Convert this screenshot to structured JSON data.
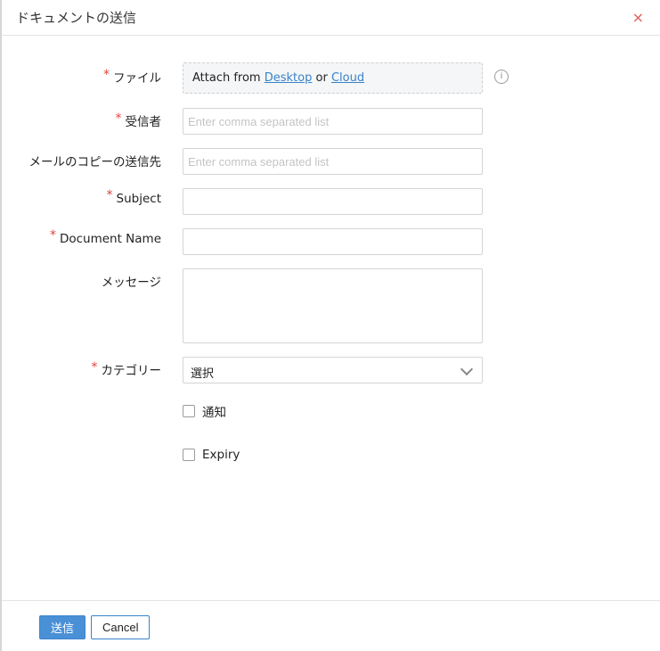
{
  "dialog": {
    "title": "ドキュメントの送信",
    "close_icon": "×"
  },
  "form": {
    "required_marker": "*",
    "file": {
      "label": "ファイル",
      "attach_prefix": "Attach from",
      "desktop_link": "Desktop",
      "or_text": "or",
      "cloud_link": "Cloud",
      "info_icon": "i"
    },
    "recipients": {
      "label": "受信者",
      "placeholder": "Enter comma separated list",
      "value": ""
    },
    "cc": {
      "label": "メールのコピーの送信先",
      "placeholder": "Enter comma separated list",
      "value": ""
    },
    "subject": {
      "label": "Subject",
      "value": ""
    },
    "document_name": {
      "label": "Document Name",
      "value": ""
    },
    "message": {
      "label": "メッセージ",
      "value": ""
    },
    "category": {
      "label": "カテゴリー",
      "selected": "選択"
    },
    "notify": {
      "label": "通知",
      "checked": false
    },
    "expiry": {
      "label": "Expiry",
      "checked": false
    }
  },
  "footer": {
    "send_label": "送信",
    "cancel_label": "Cancel"
  },
  "colors": {
    "accent": "#4a90d6",
    "link": "#3a83c9",
    "required": "#e04444",
    "close": "#e05a5a"
  }
}
